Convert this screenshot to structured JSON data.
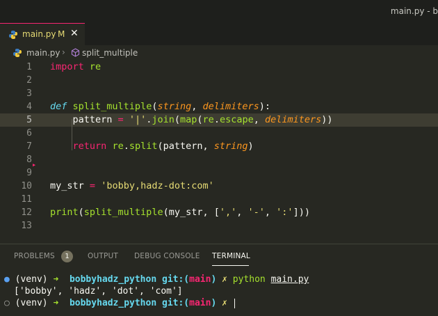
{
  "window": {
    "title": "main.py - b"
  },
  "tab": {
    "label": "main.py",
    "modified": "M",
    "close": "✕"
  },
  "breadcrumb": {
    "file": "main.py",
    "separator": "›",
    "symbol": "split_multiple"
  },
  "editor": {
    "line_numbers": [
      "1",
      "2",
      "3",
      "4",
      "5",
      "6",
      "7",
      "8",
      "9",
      "10",
      "11",
      "12",
      "13"
    ],
    "lines": [
      [
        {
          "t": "import",
          "c": "kw2"
        },
        {
          "t": " "
        },
        {
          "t": "re",
          "c": "fn"
        }
      ],
      [],
      [],
      [
        {
          "t": "def",
          "c": "kw"
        },
        {
          "t": " "
        },
        {
          "t": "split_multiple",
          "c": "fn"
        },
        {
          "t": "("
        },
        {
          "t": "string",
          "c": "param"
        },
        {
          "t": ", "
        },
        {
          "t": "delimiters",
          "c": "param"
        },
        {
          "t": "):"
        }
      ],
      [
        {
          "t": "    pattern "
        },
        {
          "t": "=",
          "c": "op"
        },
        {
          "t": " "
        },
        {
          "t": "'|'",
          "c": "str"
        },
        {
          "t": "."
        },
        {
          "t": "join",
          "c": "fn"
        },
        {
          "t": "("
        },
        {
          "t": "map",
          "c": "fn"
        },
        {
          "t": "("
        },
        {
          "t": "re",
          "c": "fn"
        },
        {
          "t": "."
        },
        {
          "t": "escape",
          "c": "fn"
        },
        {
          "t": ", "
        },
        {
          "t": "delimiters",
          "c": "param"
        },
        {
          "t": "))"
        }
      ],
      [],
      [
        {
          "t": "    "
        },
        {
          "t": "return",
          "c": "kw2"
        },
        {
          "t": " "
        },
        {
          "t": "re",
          "c": "fn"
        },
        {
          "t": "."
        },
        {
          "t": "split",
          "c": "fn"
        },
        {
          "t": "(pattern, "
        },
        {
          "t": "string",
          "c": "param"
        },
        {
          "t": ")"
        }
      ],
      [],
      [],
      [
        {
          "t": "my_str "
        },
        {
          "t": "=",
          "c": "op"
        },
        {
          "t": " "
        },
        {
          "t": "'bobby,hadz-dot:com'",
          "c": "str"
        }
      ],
      [],
      [
        {
          "t": "print",
          "c": "fn"
        },
        {
          "t": "("
        },
        {
          "t": "split_multiple",
          "c": "fn"
        },
        {
          "t": "(my_str, ["
        },
        {
          "t": "','",
          "c": "str"
        },
        {
          "t": ", "
        },
        {
          "t": "'-'",
          "c": "str"
        },
        {
          "t": ", "
        },
        {
          "t": "':'",
          "c": "str"
        },
        {
          "t": "]))"
        }
      ],
      []
    ]
  },
  "panel": {
    "tabs": {
      "problems": "PROBLEMS",
      "output": "OUTPUT",
      "debug": "DEBUG CONSOLE",
      "terminal": "TERMINAL"
    },
    "problems_count": "1"
  },
  "terminal": {
    "line1": {
      "dot": "●",
      "venv": "(venv)",
      "arrow": "➜",
      "dir": "bobbyhadz_python",
      "git": "git:(",
      "branch": "main",
      "git_close": ")",
      "x": "✗",
      "cmd": "python",
      "file": "main.py"
    },
    "output": "['bobby', 'hadz', 'dot', 'com']",
    "line3": {
      "dot": "○",
      "venv": "(venv)",
      "arrow": "➜",
      "dir": "bobbyhadz_python",
      "git": "git:(",
      "branch": "main",
      "git_close": ")",
      "x": "✗"
    }
  },
  "colors": {
    "accent": "#f92672",
    "background": "#272822",
    "function": "#a6e22e",
    "string": "#e6db74",
    "keyword": "#66d9ef",
    "param": "#fd971f"
  }
}
